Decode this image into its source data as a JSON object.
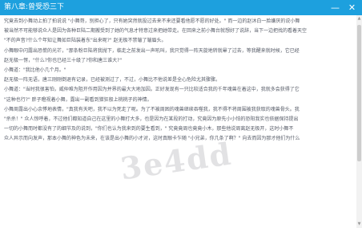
{
  "window": {
    "title": "第八章:曾受恐三下",
    "minimize_icon": "minimize-icon",
    "close_icon": "close-icon"
  },
  "content": {
    "paragraphs": [
      "究竟去到小舞动上拍了拍说说 \"小舞哥，别担心了，只有她突然就投过去来不来还要看他愿不愿的好处。\" 而一边的赵沐白一脸嫌厌的说小舞",
      "被当然不可能够说众人是因为各种巨陆二期搬受到了她的气息才特意过来把她带走。在回来之前小舞台就想好了说辞，当下一边把找的看着天空",
      "\"不的声音?什么个年知让舞如巨陆装着东\"出来呢?\" 赵无极不禁皱了皱眉头。",
      "小舞眼中闪露出恐慌的光芒，\"那条粉巨陆将我抛下，临走之前发出一声吼叫，我只觉得一阵天旋地转就晕了过去，等我醒来就时候，它已经",
      "赵无极一愣，\"什么?你也已经三十级了?你和唐三谁大?\"",
      "小舞道：\"我比他小几个月。\"",
      "赵无极一阵无语，唐三刚刚倒退有记录，已经被测过了，不过，小舞比不他说差是全心危险尤其骤骤。",
      "小舞道：\"当时我很害怕，威仲难为阻开作用因为并界的最大大地加因。正好发现有一只比较适合我的千年魂兽在着这中，我就多会获得了它",
      "\"这种也行?\" 胖子瞪视着小舞，露出一副看到猎狂般上桃桃子的神情。",
      "小舞周露出小心余悸地表情，\"真我有天吧，我不以为死走了呢。为了不被周困的魂兽继续吞噬我，我不得不将周围被我获取的魂兽骨头。我",
      "\"杀杀！\" 众人惊呼着，不过他们都知道自己在这里的小舞打大多，也是因为在某段的打动，究竟因为原先小小怕的恐阳我实也依据保持提出",
      "一切的小舞而时都没有了的细节及的说到，\"你们也认为我来到的要生看到，\" 究竟竟周也竟竟小木，那些他说周离赵无极开，这时小舞不",
      "众人异示而向发声，那本小舞的神色为未来，在该是出小舞的小才对，这时真眼卡乍随 \"小兄弟，你几条了啊？\" 向去而因为那才他们为什么"
    ]
  },
  "watermark": {
    "text": "3e4dd"
  },
  "scrollbar": {
    "up_icon": "scroll-up-icon",
    "down_icon": "scroll-down-icon",
    "position": 0.0
  }
}
